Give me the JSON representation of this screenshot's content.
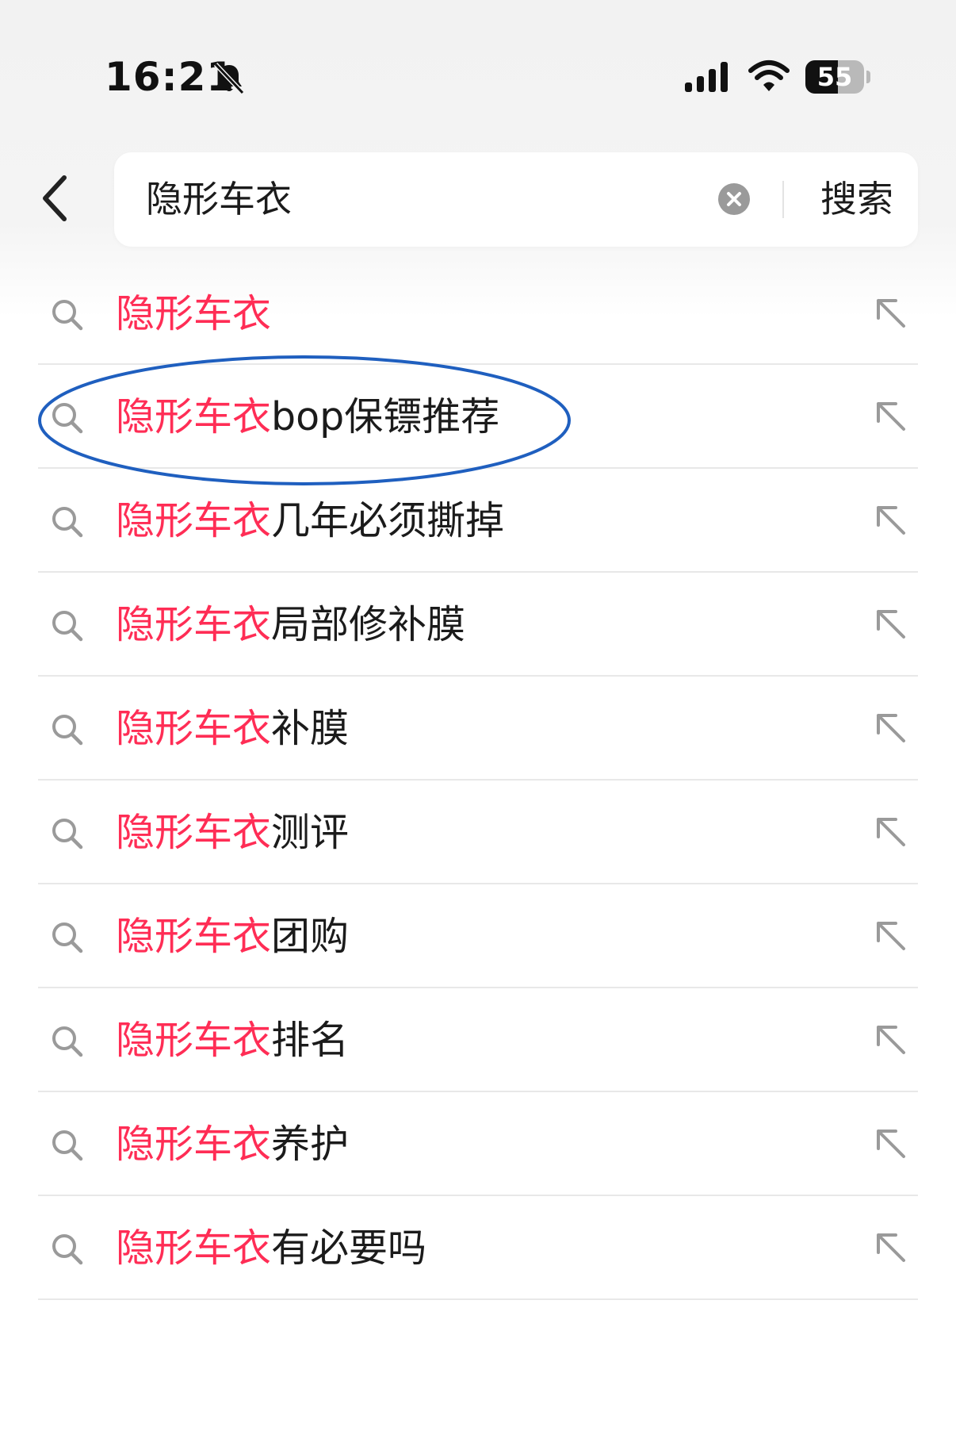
{
  "status_bar": {
    "time": "16:21",
    "battery": "55",
    "battery_fraction": 0.55
  },
  "search": {
    "query": "隐形车衣",
    "submit_label": "搜索"
  },
  "suggestions": [
    {
      "highlight": "隐形车衣",
      "rest": ""
    },
    {
      "highlight": "隐形车衣",
      "rest": "bop保镖推荐"
    },
    {
      "highlight": "隐形车衣",
      "rest": "几年必须撕掉"
    },
    {
      "highlight": "隐形车衣",
      "rest": "局部修补膜"
    },
    {
      "highlight": "隐形车衣",
      "rest": "补膜"
    },
    {
      "highlight": "隐形车衣",
      "rest": "测评"
    },
    {
      "highlight": "隐形车衣",
      "rest": "团购"
    },
    {
      "highlight": "隐形车衣",
      "rest": "排名"
    },
    {
      "highlight": "隐形车衣",
      "rest": "养护"
    },
    {
      "highlight": "隐形车衣",
      "rest": "有必要吗"
    }
  ],
  "icons": {
    "back": "chevron-left-icon",
    "clear": "clear-circle-icon",
    "suggestion": "search-icon",
    "fill": "arrow-up-left-icon",
    "status": [
      "bell-slash-icon",
      "signal-icon",
      "wifi-icon",
      "battery-icon"
    ]
  },
  "colors": {
    "highlight": "#ff2d55",
    "annotation": "#1f5fbf",
    "text": "#1b1b1b",
    "icon_gray": "#9a9a9a"
  }
}
